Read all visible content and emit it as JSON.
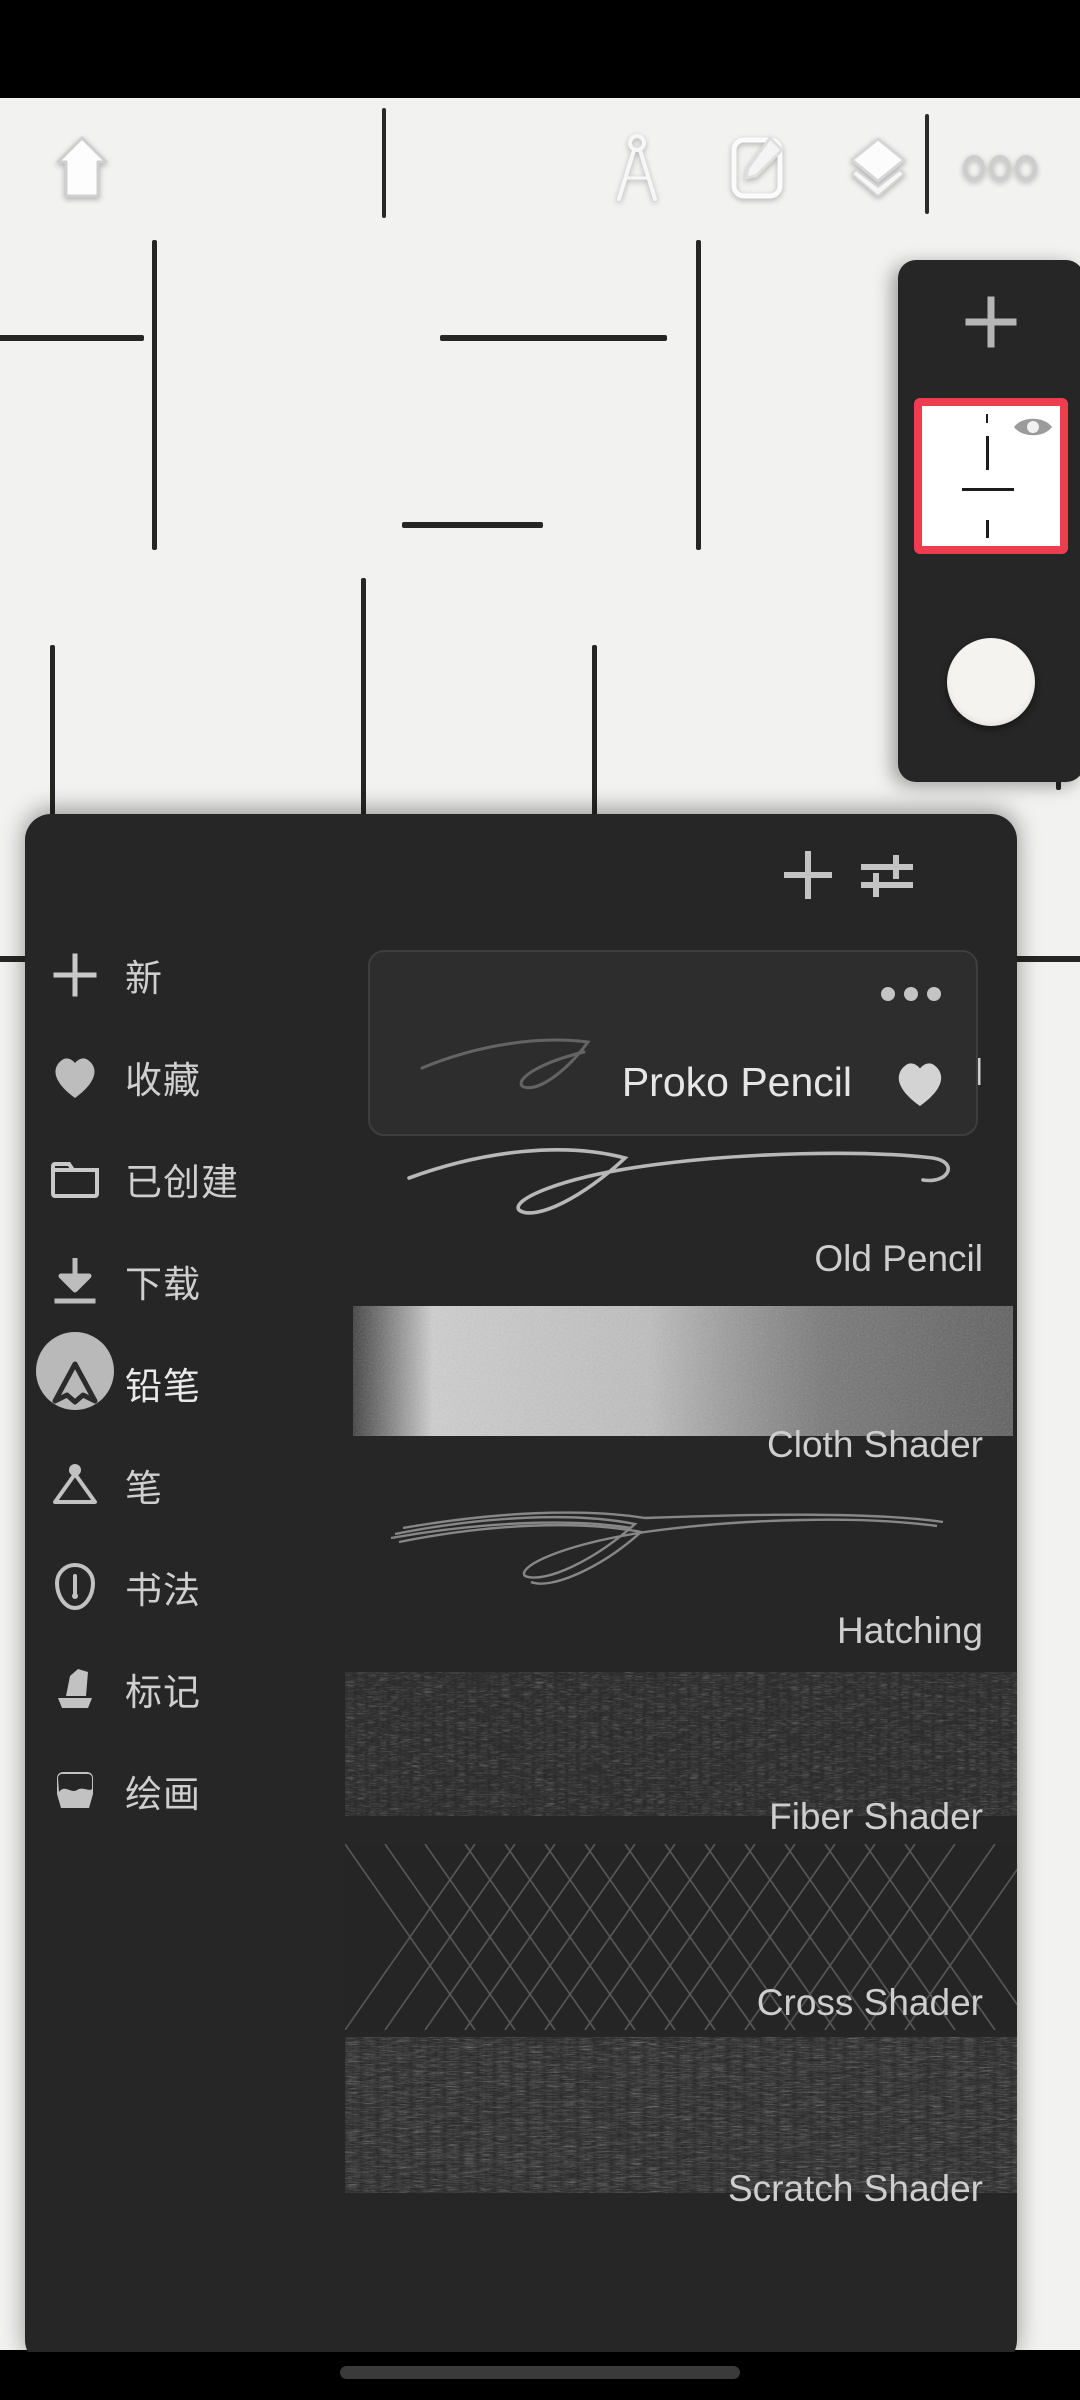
{
  "app": {
    "theme_panel_color": "#262626",
    "accent_red": "#ee3d4e",
    "canvas_color": "#f2f2f1"
  },
  "toolbar": {
    "items": [
      {
        "name": "home-icon",
        "label": "Home"
      },
      {
        "name": "compass-icon",
        "label": "Compass"
      },
      {
        "name": "edit-square-icon",
        "label": "Edit"
      },
      {
        "name": "layers-icon",
        "label": "Layers"
      },
      {
        "name": "more-dots-icon",
        "label": "More"
      }
    ]
  },
  "layers_panel": {
    "add_label": "+",
    "layer_selected": true,
    "visibility_icon": "eye-icon",
    "color_swatch": "#f5f3f0"
  },
  "brush_panel": {
    "header": {
      "add_label": "+",
      "add_icon": "plus-icon",
      "settings_icon": "sliders-icon"
    },
    "sidebar": {
      "items": [
        {
          "label": "新",
          "icon": "plus-icon",
          "active": false
        },
        {
          "label": "收藏",
          "icon": "heart-icon",
          "active": false
        },
        {
          "label": "已创建",
          "icon": "folder-icon",
          "active": false
        },
        {
          "label": "下载",
          "icon": "download-icon",
          "active": false
        },
        {
          "label": "铅笔",
          "icon": "pencil-icon",
          "active": true
        },
        {
          "label": "笔",
          "icon": "pen-icon",
          "active": false
        },
        {
          "label": "书法",
          "icon": "calligraphy-icon",
          "active": false
        },
        {
          "label": "标记",
          "icon": "marker-icon",
          "active": false
        },
        {
          "label": "绘画",
          "icon": "paint-bucket-icon",
          "active": false
        }
      ]
    },
    "selected_brush": {
      "name": "Proko Pencil",
      "favorited": true,
      "menu_icon": "more-dots-icon",
      "heart_icon": "heart-icon"
    },
    "brushes": [
      {
        "name": "Waxy Pencil",
        "style": "waxy",
        "occluded": true
      },
      {
        "name": "Old Pencil",
        "style": "line",
        "occluded": false
      },
      {
        "name": "Cloth Shader",
        "style": "cloth",
        "occluded": false
      },
      {
        "name": "Hatching",
        "style": "hatch",
        "occluded": false
      },
      {
        "name": "Fiber Shader",
        "style": "fiber",
        "occluded": false
      },
      {
        "name": "Cross Shader",
        "style": "cross",
        "occluded": false
      },
      {
        "name": "Scratch Shader",
        "style": "scratch",
        "occluded": false
      }
    ]
  },
  "navbar": {
    "gesture_pill": ""
  }
}
